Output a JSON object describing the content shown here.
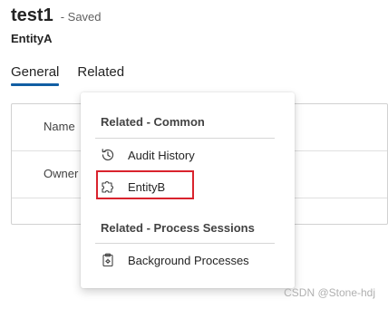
{
  "record": {
    "name": "test1",
    "status": "- Saved",
    "entity": "EntityA"
  },
  "tabs": [
    {
      "label": "General",
      "active": true
    },
    {
      "label": "Related",
      "active": false
    }
  ],
  "form": {
    "fields": [
      {
        "label": "Name"
      },
      {
        "label": "Owner"
      }
    ]
  },
  "flyout": {
    "sections": [
      {
        "title": "Related - Common",
        "items": [
          {
            "label": "Audit History",
            "icon": "history-icon"
          },
          {
            "label": "EntityB",
            "icon": "puzzle-icon",
            "highlighted": true
          }
        ]
      },
      {
        "title": "Related - Process Sessions",
        "items": [
          {
            "label": "Background Processes",
            "icon": "clipboard-gear-icon"
          }
        ]
      }
    ]
  },
  "colors": {
    "accent": "#115ea3",
    "highlight": "#d9232d"
  },
  "watermark": "CSDN @Stone-hdj"
}
